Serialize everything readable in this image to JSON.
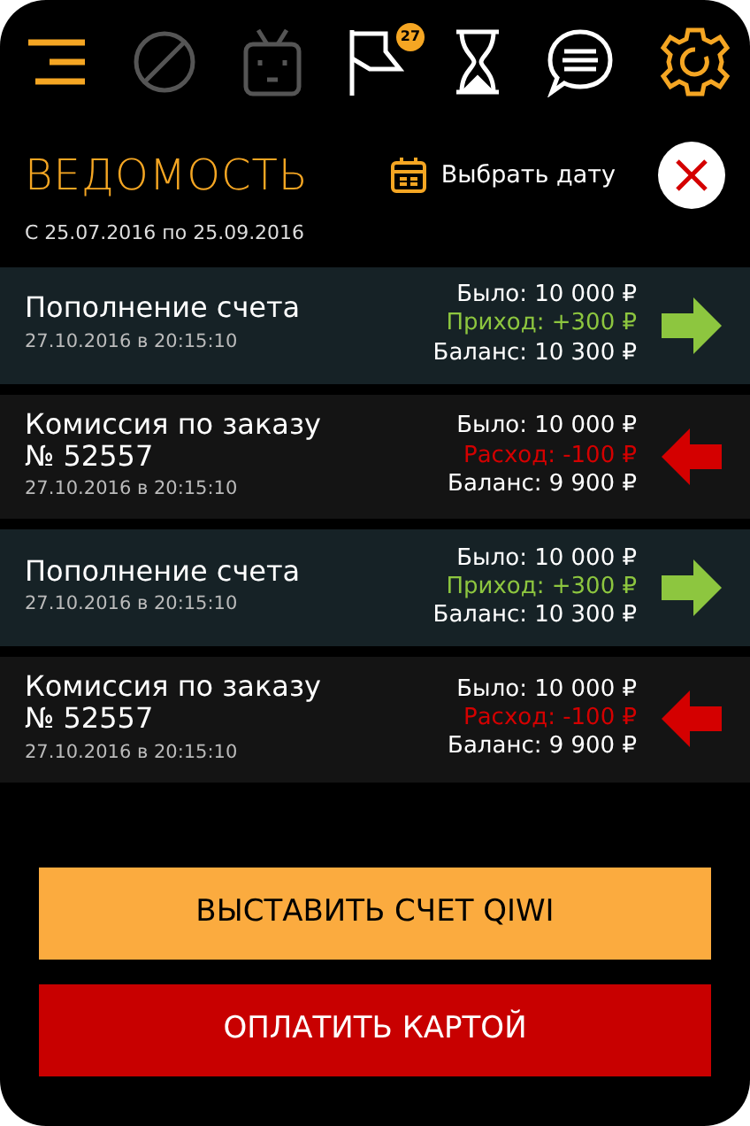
{
  "toolbar": {
    "notification_badge": "27"
  },
  "header": {
    "title": "ВЕДОМОСТЬ",
    "date_button": "Выбрать дату",
    "period": "С 25.07.2016 по 25.09.2016"
  },
  "transactions": [
    {
      "kind": "income",
      "title": "Пополнение счета",
      "time": "27.10.2016 в 20:15:10",
      "was": "Было: 10 000 ₽",
      "change": "Приход: +300 ₽",
      "balance": "Баланс: 10 300 ₽"
    },
    {
      "kind": "expense",
      "title": "Комиссия по заказу № 52557",
      "time": "27.10.2016 в 20:15:10",
      "was": "Было: 10 000 ₽",
      "change": "Расход: -100 ₽",
      "balance": "Баланс: 9 900 ₽"
    },
    {
      "kind": "income",
      "title": "Пополнение счета",
      "time": "27.10.2016 в 20:15:10",
      "was": "Было: 10 000 ₽",
      "change": "Приход: +300 ₽",
      "balance": "Баланс: 10 300 ₽"
    },
    {
      "kind": "expense",
      "title": "Комиссия по заказу № 52557",
      "time": "27.10.2016 в 20:15:10",
      "was": "Было: 10 000 ₽",
      "change": "Расход: -100 ₽",
      "balance": "Баланс: 9 900 ₽"
    }
  ],
  "buttons": [
    {
      "kind": "qiwi",
      "label": "ВЫСТАВИТЬ СЧЕТ QIWI"
    },
    {
      "kind": "card",
      "label": "ОПЛАТИТЬ КАРТОЙ"
    }
  ]
}
